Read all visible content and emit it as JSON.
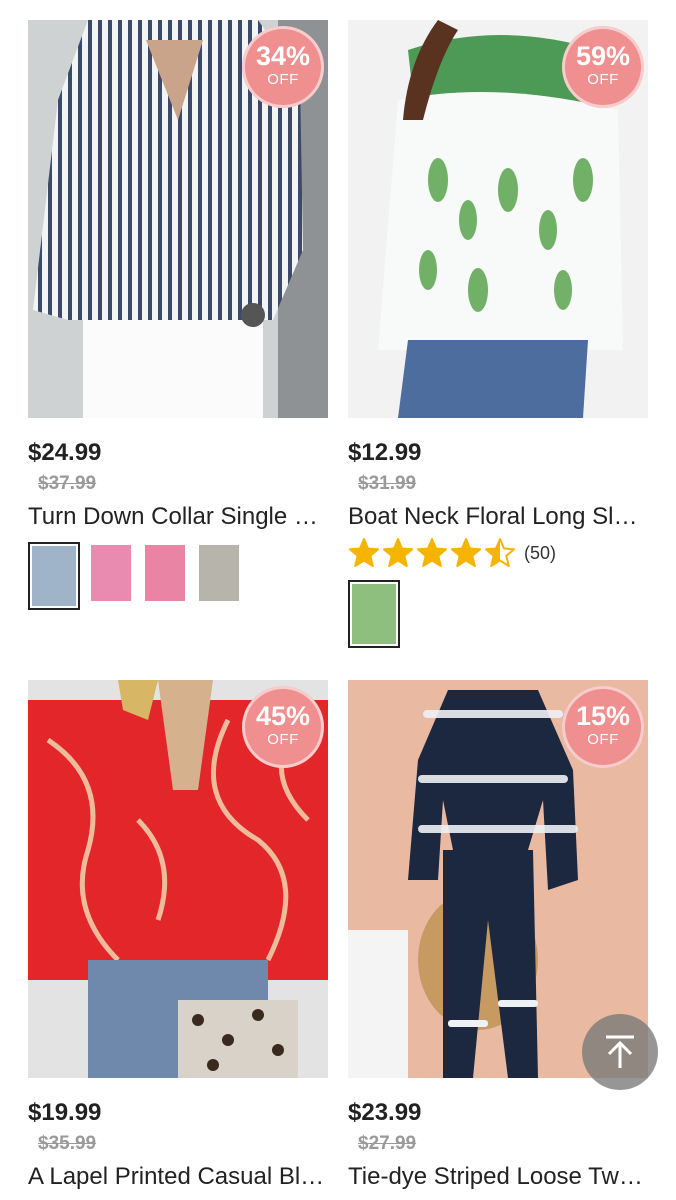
{
  "products": [
    {
      "price": "$24.99",
      "old_price": "$37.99",
      "title": "Turn Down Collar Single Breasted Stripe Blouse",
      "discount_pct": "34%",
      "discount_off": "OFF",
      "swatch_colors": [
        "#9fb3c9",
        "#e98bb1",
        "#ea84a4",
        "#b7b4ac"
      ]
    },
    {
      "price": "$12.99",
      "old_price": "$31.99",
      "title": "Boat Neck Floral Long Sleeve Blouse",
      "discount_pct": "59%",
      "discount_off": "OFF",
      "rating": 4.5,
      "rating_count": "(50)",
      "swatch_colors": [
        "#8fbf7e"
      ]
    },
    {
      "price": "$19.99",
      "old_price": "$35.99",
      "title": "A Lapel Printed Casual Blouse",
      "discount_pct": "45%",
      "discount_off": "OFF"
    },
    {
      "price": "$23.99",
      "old_price": "$27.99",
      "title": "Tie-dye Striped Loose Two Piece Set",
      "discount_pct": "15%",
      "discount_off": "OFF"
    }
  ],
  "colors": {
    "badge": "#ef8f8f",
    "star": "#f5b400",
    "text": "#222222",
    "old_price": "#9a9a9a"
  },
  "icons": {
    "back_to_top": "arrow-up-icon",
    "star": "star-icon"
  }
}
